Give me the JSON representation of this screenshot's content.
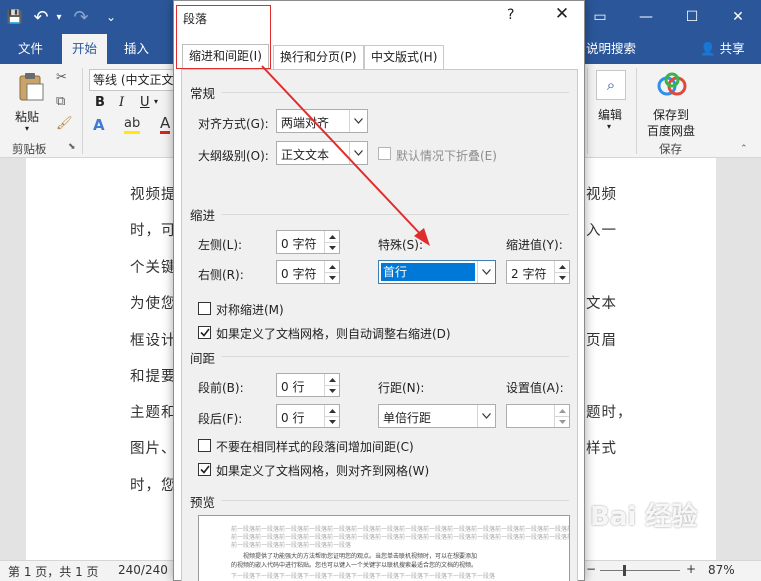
{
  "qat": {
    "save": "💾",
    "undo": "↶",
    "undo_more": "▾",
    "redo": "↷",
    "customize": "⌄"
  },
  "window_controls": {
    "restore": "▭",
    "minimize": "—",
    "maximize": "☐",
    "close": "✕"
  },
  "ribbon_tabs": {
    "file": "文件",
    "home": "开始",
    "insert": "插入",
    "tell_me": "说明搜索",
    "share": "共享"
  },
  "ribbon": {
    "paste": "粘贴",
    "clipboard_group": "剪贴板",
    "font_name": "等线 (中文正文",
    "bold": "B",
    "italic": "I",
    "underline": "U",
    "font_color": "A",
    "edit": "编辑",
    "save_to_baidu": "保存到",
    "baidu_cloud": "百度网盘",
    "save_group": "保存"
  },
  "document": {
    "left_lines": [
      "视频提",
      "时，可",
      "个关键",
      "为使您",
      "框设计",
      "和提要",
      "主题和",
      "图片、",
      "时，您"
    ],
    "right_lines": [
      "视频",
      "入一",
      "文本",
      "页眉",
      "",
      "题时，",
      "样式"
    ]
  },
  "status": {
    "page": "第 1 页，共 1 页",
    "words": "240/240",
    "zoom": "87%"
  },
  "dialog": {
    "title": "段落",
    "help": "?",
    "close": "✕",
    "tabs": {
      "indent_spacing": "缩进和间距(I)",
      "line_page": "换行和分页(P)",
      "asian": "中文版式(H)"
    },
    "general": {
      "heading": "常规",
      "alignment_label": "对齐方式(G):",
      "alignment_value": "两端对齐",
      "outline_label": "大纲级别(O):",
      "outline_value": "正文文本",
      "collapsed_label": "默认情况下折叠(E)"
    },
    "indent": {
      "heading": "缩进",
      "left_label": "左侧(L):",
      "left_value": "0 字符",
      "right_label": "右侧(R):",
      "right_value": "0 字符",
      "special_label": "特殊(S):",
      "special_value": "首行",
      "by_label": "缩进值(Y):",
      "by_value": "2 字符",
      "mirror_label": "对称缩进(M)",
      "auto_adjust_label": "如果定义了文档网格，则自动调整右缩进(D)"
    },
    "spacing": {
      "heading": "间距",
      "before_label": "段前(B):",
      "before_value": "0 行",
      "after_label": "段后(F):",
      "after_value": "0 行",
      "line_label": "行距(N):",
      "line_value": "单倍行距",
      "at_label": "设置值(A):",
      "at_value": "",
      "no_space_label": "不要在相同样式的段落间增加间距(C)",
      "snap_grid_label": "如果定义了文档网格，则对齐到网格(W)"
    },
    "preview": {
      "heading": "预览",
      "line_prev": "前一段落前一段落前一段落前一段落前一段落前一段落前一段落前一段落前一段落前一段落前一段落前一段落前一段落前一段落前一段落",
      "line_prev_short": "前一段落前一段落前一段落前一段落前一段落",
      "line_sample1": "视频提供了功能强大的方法帮助您证明您的观点。当您单击联机视频时，可以在想要添加",
      "line_sample2": "的视频的嵌入代码中进行粘贴。您也可以键入一个关键字以联机搜索最适合您的文档的视频。",
      "line_next": "下一段落下一段落下一段落下一段落下一段落下一段落下一段落下一段落下一段落下一段落下一段落"
    }
  },
  "watermark": "Bai 经验",
  "colors": {
    "word_blue": "#2b579a",
    "selection": "#0078d7",
    "annotation": "#e02c2c"
  }
}
